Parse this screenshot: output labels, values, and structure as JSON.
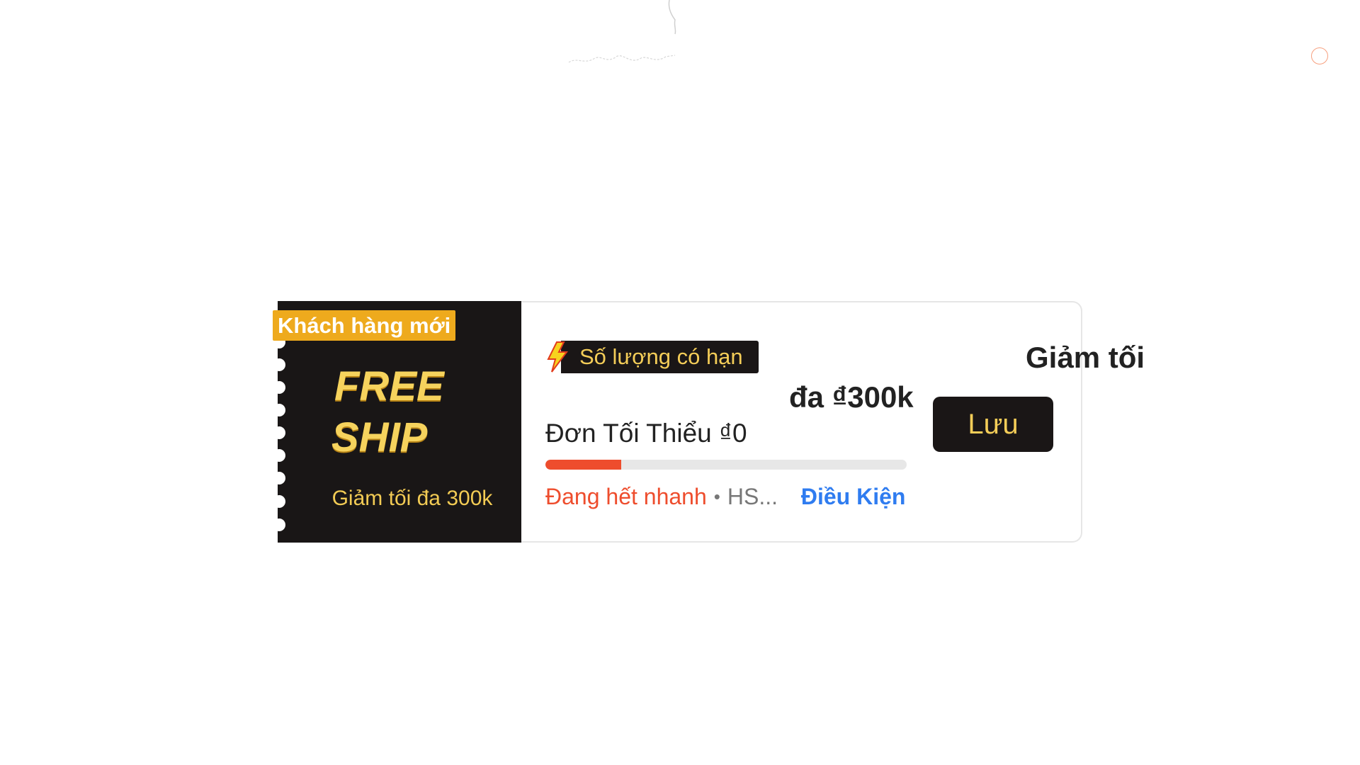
{
  "voucher": {
    "badge": "Khách hàng mới",
    "free_line1": "FREE",
    "free_line2": "SHIP",
    "left_subtitle": "Giảm tối đa 300k",
    "tag_label": "Số lượng có hạn",
    "title": "Giảm tối đa ₫300k",
    "min_order": "Đơn Tối Thiểu ₫0",
    "progress_fraction": 0.21,
    "status": "Đang hết nhanh",
    "expiry_prefix": "HS...",
    "terms_link": "Điều Kiện",
    "save_button": "Lưu",
    "colors": {
      "dark": "#191616",
      "gold": "#f4cd58",
      "badge": "#eeaa1d",
      "accent_red": "#ee4d2d",
      "link_blue": "#2f7cf0"
    }
  },
  "icons": {
    "lightning": "lightning-icon",
    "spinner": "loading-spinner-icon"
  }
}
